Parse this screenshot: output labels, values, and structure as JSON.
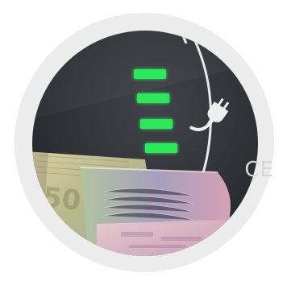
{
  "image": {
    "subject": "euro-banknotes-in-front-of-ev-charging-display",
    "overlay_text": "CE",
    "colors": {
      "background": "#ffffff",
      "outer_ring": "#ececec",
      "display_dark": "#2c2e33",
      "display_light": "#3d4047",
      "battery_bar": "#2ee85c",
      "battery_bar_glow": "#7dffa0",
      "gauge_arc": "#e9e9e9",
      "plug_icon": "#eeeeee",
      "note_tan": "#c9c08a",
      "note_green": "#9fb58a",
      "note_purple": "#b99ab8",
      "note_pink": "#e6a7b6"
    },
    "icons": [
      "ev-plug-icon",
      "battery-level-icon"
    ],
    "battery_level": {
      "bars_lit": 4
    }
  }
}
